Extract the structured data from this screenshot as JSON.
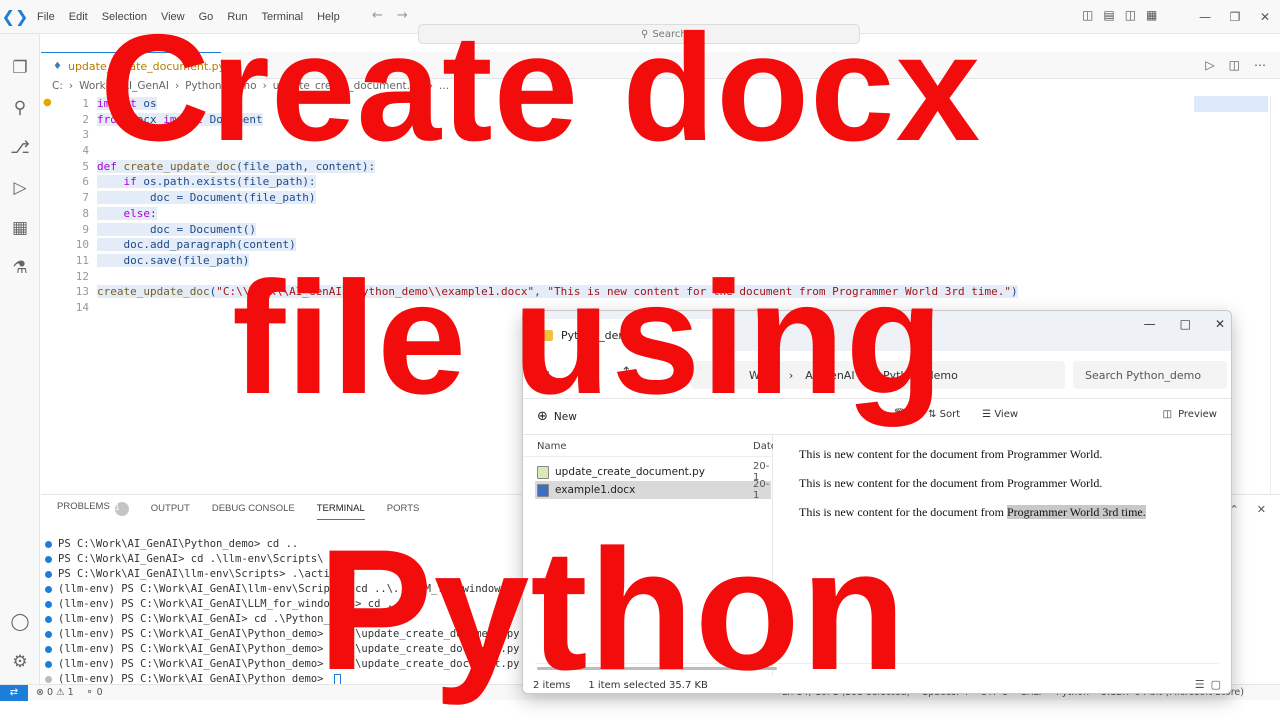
{
  "titlebar": {
    "menu": [
      "File",
      "Edit",
      "Selection",
      "View",
      "Go",
      "Run",
      "Terminal",
      "Help"
    ],
    "search_placeholder": "Search"
  },
  "editor": {
    "tab_label": "update_create_document.py",
    "tab_problems": "1",
    "breadcrumb": [
      "C:",
      "Work",
      "AI_GenAI",
      "Python_demo",
      "update_create_document.py",
      "..."
    ],
    "line_numbers": [
      "1",
      "2",
      "3",
      "4",
      "5",
      "6",
      "7",
      "8",
      "9",
      "10",
      "11",
      "12",
      "13",
      "14"
    ],
    "code": {
      "l1_kw": "import",
      "l1_rest": " os",
      "l2_kw": "from",
      "l2_mod": " docx ",
      "l2_kw2": "import",
      "l2_rest": " Document",
      "l5_kw": "def",
      "l5_fn": " create_update_doc",
      "l5_rest": "(file_path, content):",
      "l6_indent": "    ",
      "l6_kw": "if",
      "l6_rest": " os.path.exists(file_path):",
      "l7_indent": "        ",
      "l7_rest": "doc = Document(file_path)",
      "l8_indent": "    ",
      "l8_kw": "else",
      "l8_rest": ":",
      "l9_indent": "        ",
      "l9_rest": "doc = Document()",
      "l10_indent": "    ",
      "l10_rest": "doc.add_paragraph(content)",
      "l11_indent": "    ",
      "l11_rest": "doc.save(file_path)",
      "l13_fn": "create_update_doc",
      "l13_open": "(",
      "l13_str1": "\"C:\\\\Work\\\\AI_GenAI\\\\Python_demo\\\\example1.docx\"",
      "l13_sep": ", ",
      "l13_str2": "\"This is new content for the document from Programmer World 3rd time.\"",
      "l13_close": ")"
    }
  },
  "panel": {
    "tabs": [
      "PROBLEMS",
      "OUTPUT",
      "DEBUG CONSOLE",
      "TERMINAL",
      "PORTS"
    ],
    "problems_count": "1",
    "terminal_lines": [
      "PS C:\\Work\\AI_GenAI\\Python_demo> cd ..",
      "PS C:\\Work\\AI_GenAI> cd .\\llm-env\\Scripts\\",
      "PS C:\\Work\\AI_GenAI\\llm-env\\Scripts> .\\activate",
      "(llm-env) PS C:\\Work\\AI_GenAI\\llm-env\\Scripts> cd ..\\..\\LLM_for_windowsOS\\",
      "(llm-env) PS C:\\Work\\AI_GenAI\\LLM_for_windowsOS> cd ..",
      "(llm-env) PS C:\\Work\\AI_GenAI> cd .\\Python_demo\\",
      "(llm-env) PS C:\\Work\\AI_GenAI\\Python_demo> py .\\update_create_document.py",
      "(llm-env) PS C:\\Work\\AI_GenAI\\Python_demo> py .\\update_create_document.py",
      "(llm-env) PS C:\\Work\\AI_GenAI\\Python_demo> py .\\update_create_document.py",
      "(llm-env) PS C:\\Work\\AI_GenAI\\Python_demo> "
    ]
  },
  "statusbar": {
    "errors": "0",
    "warnings": "1",
    "ports": "0",
    "right": [
      "Ln 14, Col 1 (393 selected)",
      "Spaces: 4",
      "UTF-8",
      "CRLF",
      "Python",
      "3.12.7 64-bit (Microsoft Store)"
    ]
  },
  "explorer": {
    "tab_title": "Python_demo",
    "path": [
      "Work",
      "AI_GenAI",
      "Python_demo"
    ],
    "search_placeholder": "Search Python_demo",
    "new_label": "New",
    "sort_label": "Sort",
    "view_label": "View",
    "preview_label": "Preview",
    "col_name": "Name",
    "col_date": "Date",
    "files": [
      {
        "name": "update_create_document.py",
        "date": "20-1"
      },
      {
        "name": "example1.docx",
        "date": "20-1"
      }
    ],
    "preview_lines": [
      "This is new content for the document from Programmer World.",
      "This is new content for the document from Programmer World."
    ],
    "preview_line3_plain": "This is new content for the document from ",
    "preview_line3_hl": "Programmer World 3rd time.",
    "status_items": "2 items",
    "status_selected": "1 item selected  35.7 KB"
  },
  "overlay": {
    "line1": "Create docx",
    "line2": "file using",
    "line3": "Python"
  },
  "colors": {
    "accent": "#1c7ed6",
    "overlay_red": "#f20c0c"
  }
}
